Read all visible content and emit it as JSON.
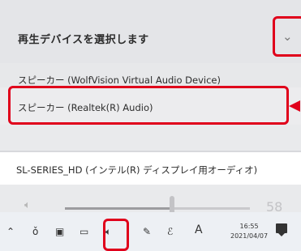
{
  "panel": {
    "title": "再生デバイスを選択します",
    "collapse_icon": "chevron-down-icon"
  },
  "devices": [
    {
      "label": "スピーカー (WolfVision Virtual Audio Device)",
      "selected": false
    },
    {
      "label": "スピーカー (Realtek(R) Audio)",
      "selected": false
    },
    {
      "label": "SL-SERIES_HD (インテル(R) ディスプレイ用オーディオ)",
      "selected": true
    }
  ],
  "volume": {
    "icon": "speaker-icon",
    "value_text": "58",
    "level": 0.58
  },
  "taskbar": {
    "icons": [
      "chevron-up-icon",
      "usb-icon",
      "tablet-icon",
      "battery-icon",
      "speaker-icon",
      "pen-icon",
      "stylus-icon",
      "ime-icon"
    ],
    "ime_label": "A",
    "time": "16:55",
    "date": "2021/04/07",
    "notification_icon": "notification-icon"
  },
  "annotation_color": "#e0001b"
}
